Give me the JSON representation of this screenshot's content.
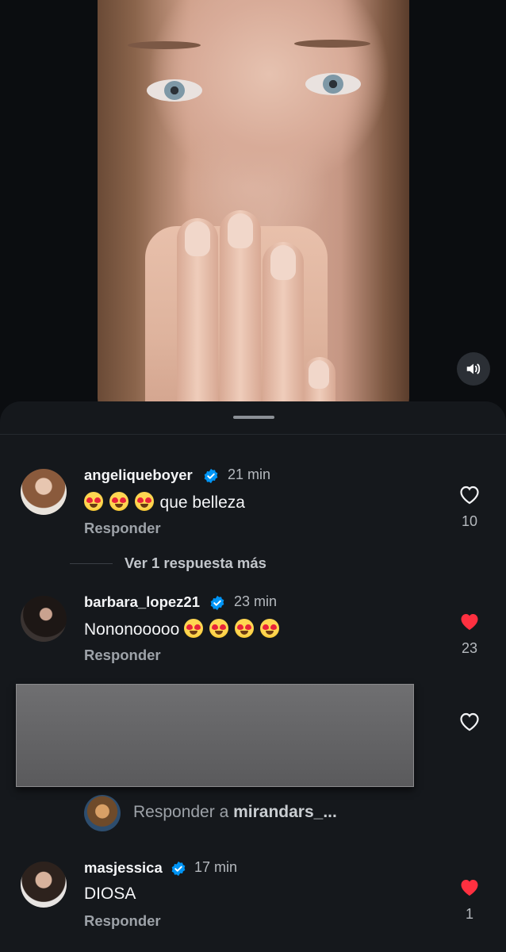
{
  "video": {
    "sound_icon": "speaker-icon"
  },
  "comments": [
    {
      "username": "angeliqueboyer",
      "time": "21 min",
      "emoji_count": 3,
      "text": "que belleza",
      "reply_label": "Responder",
      "likes": "10",
      "liked": false
    },
    {
      "username": "barbara_lopez21",
      "time": "23 min",
      "text": "Nononooooo",
      "emoji_count": 4,
      "reply_label": "Responder",
      "likes": "23",
      "liked": true
    },
    {
      "username": "masjessica",
      "time": "17 min",
      "text": "DIOSA",
      "reply_label": "Responder",
      "likes": "1",
      "liked": true
    }
  ],
  "more_replies": "Ver 1 respuesta más",
  "reply_box": {
    "prefix": "Responder a ",
    "target": "mirandars_..."
  },
  "colors": {
    "like_red": "#ff3040",
    "verified_blue": "#0095f6",
    "sheet_bg": "#15181c"
  }
}
